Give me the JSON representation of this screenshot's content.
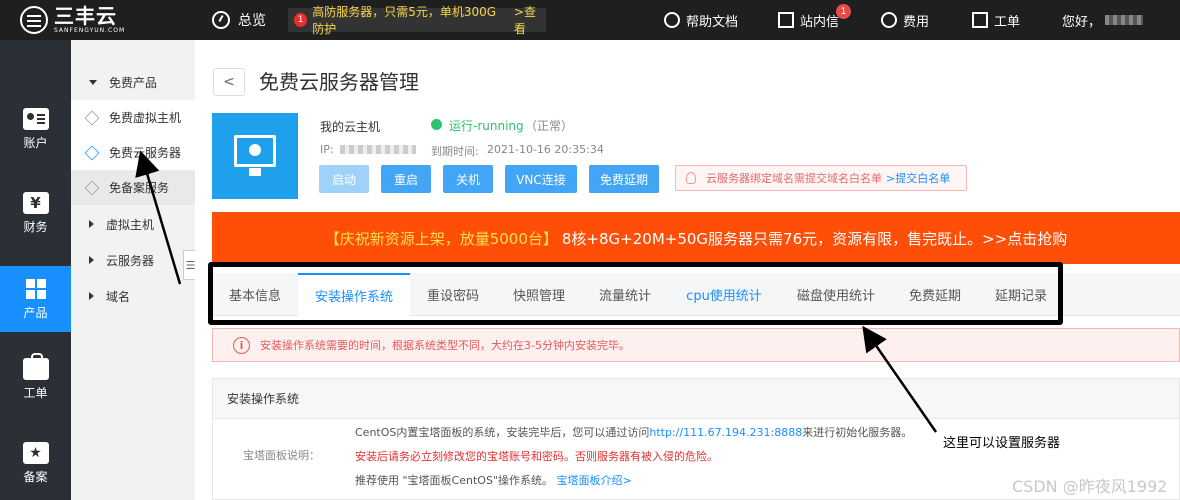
{
  "header": {
    "logo_cn": "三丰云",
    "logo_en": "SANFENGYUN.COM",
    "home_label": "总览",
    "promo_badge": "1",
    "promo_text": "高防服务器，只需5元，单机300G防护",
    "promo_link": ">查看",
    "help_label": "帮助文档",
    "mail_label": "站内信",
    "mail_count": "1",
    "fee_label": "费用",
    "ticket_label": "工单",
    "greeting": "您好，"
  },
  "sidebar": {
    "items": [
      {
        "label": "账户",
        "icon": "user-card-icon"
      },
      {
        "label": "财务",
        "icon": "yen-icon"
      },
      {
        "label": "产品",
        "icon": "grid-icon"
      },
      {
        "label": "工单",
        "icon": "bag-icon"
      },
      {
        "label": "备案",
        "icon": "star-icon"
      }
    ],
    "active": "产品"
  },
  "submenu": {
    "free_group": "免费产品",
    "items": [
      {
        "label": "免费虚拟主机"
      },
      {
        "label": "免费云服务器"
      },
      {
        "label": "免备案服务"
      }
    ],
    "groups": [
      "虚拟主机",
      "云服务器",
      "域名"
    ]
  },
  "page": {
    "back": "<",
    "title": "免费云服务器管理"
  },
  "vm": {
    "name": "我的云主机",
    "status": "运行-running",
    "status_note": "（正常）",
    "ip_label": "IP:",
    "expire_label": "到期时间:",
    "expire_value": "2021-10-16 20:35:34",
    "buttons": [
      "启动",
      "重启",
      "关机",
      "VNC连接",
      "免费延期"
    ],
    "notice": "云服务器绑定域名需提交域名白名单",
    "notice_link": ">提交白名单"
  },
  "banner": {
    "highlight": "【庆祝新资源上架，放量5000台】",
    "text": "8核+8G+20M+50G服务器只需76元，资源有限，售完既止。>>点击抢购"
  },
  "tabs": [
    "基本信息",
    "安装操作系统",
    "重设密码",
    "快照管理",
    "流量统计",
    "cpu使用统计",
    "磁盘使用统计",
    "免费延期",
    "延期记录"
  ],
  "active_tab": "安装操作系统",
  "alert": {
    "icon": "i",
    "text": "安装操作系统需要的时间，根据系统类型不同，大约在3-5分钟内安装完毕。"
  },
  "install": {
    "heading": "安装操作系统",
    "field_label": "宝塔面板说明：",
    "line1_pre": "CentOS内置宝塔面板的系统，安装完毕后，您可以通过访问",
    "line1_link": "http://111.67.194.231:8888",
    "line1_post": "来进行初始化服务器。",
    "line2": "安装后请务必立刻修改您的宝塔账号和密码。否则服务器有被入侵的危险。",
    "line3_pre": "推荐使用 \"宝塔面板CentOS\"操作系统。",
    "line3_link": "宝塔面板介绍>"
  },
  "annotation": "这里可以设置服务器",
  "watermark": "CSDN @昨夜风1992",
  "colors": {
    "accent": "#1890ff",
    "topbar": "#1f1f1f",
    "sidebar": "#2b2f36",
    "banner": "#ff4e08",
    "running": "#2dc26b"
  }
}
